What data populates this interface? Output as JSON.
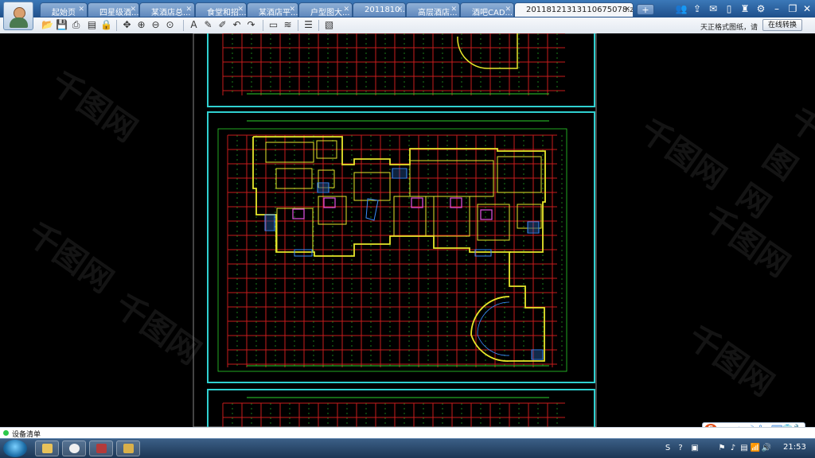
{
  "tabs": [
    {
      "label": "起始页",
      "active": false
    },
    {
      "label": "四星级酒...",
      "active": false
    },
    {
      "label": "某酒店总...",
      "active": false
    },
    {
      "label": "食堂和招...",
      "active": false
    },
    {
      "label": "某酒店平...",
      "active": false
    },
    {
      "label": "户型图大...",
      "active": false
    },
    {
      "label": "2011810...",
      "active": false
    },
    {
      "label": "高层酒店...",
      "active": false
    },
    {
      "label": "酒吧CAD...",
      "active": false
    },
    {
      "label": "20118121313110675078.zi...",
      "active": true
    }
  ],
  "tab_add_label": "+",
  "window_icons": [
    "users-icon",
    "share-icon",
    "chat-icon",
    "phone-icon",
    "tshirt-icon",
    "gear-icon",
    "minimize-icon",
    "restore-icon",
    "close-icon"
  ],
  "window_glyphs": [
    "👥",
    "⇪",
    "✉",
    "▯",
    "♜",
    "⚙",
    "–",
    "❐",
    "✕"
  ],
  "toolbar": {
    "tools": [
      {
        "name": "open-folder-icon",
        "glyph": "📂"
      },
      {
        "name": "save-icon",
        "glyph": "💾"
      },
      {
        "name": "print-icon",
        "glyph": "⎙"
      },
      {
        "name": "pdf-icon",
        "glyph": "▤"
      },
      {
        "name": "lock-icon",
        "glyph": "🔒"
      },
      {
        "name": "pan-icon",
        "glyph": "✥"
      },
      {
        "name": "zoom-in-icon",
        "glyph": "⊕"
      },
      {
        "name": "zoom-out-icon",
        "glyph": "⊖"
      },
      {
        "name": "zoom-extent-icon",
        "glyph": "⊙"
      },
      {
        "name": "text-icon",
        "glyph": "A"
      },
      {
        "name": "pencil-icon",
        "glyph": "✎"
      },
      {
        "name": "brush-icon",
        "glyph": "✐"
      },
      {
        "name": "undo-icon",
        "glyph": "↶"
      },
      {
        "name": "redo-icon",
        "glyph": "↷"
      },
      {
        "name": "measure-icon",
        "glyph": "▭"
      },
      {
        "name": "dimension-icon",
        "glyph": "≋"
      },
      {
        "name": "layers-icon",
        "glyph": "☰"
      },
      {
        "name": "properties-icon",
        "glyph": "▧"
      }
    ],
    "format_note": "天正格式图纸，请",
    "online_convert": "在线转换"
  },
  "watermark": "千图网",
  "status": {
    "text": "设备清单",
    "dot_color": "#2cc84a"
  },
  "ime": {
    "logo": "S",
    "mode": "中",
    "icons": [
      "☽",
      "°,",
      "⌨",
      "👕",
      "🔧"
    ]
  },
  "tray_glyphs": [
    "S",
    "?",
    "▣",
    "⚑",
    "♪",
    "▤",
    "📶",
    "🔊"
  ],
  "clock": "21:53",
  "colors": {
    "cad_background": "#000000",
    "frame": "#2fd0d0",
    "grid_red": "#c81c1c",
    "grid_green": "#2bd12b",
    "wall_yellow": "#e6e62a",
    "stair_blue": "#3a8cff",
    "magenta": "#d34cd3"
  }
}
